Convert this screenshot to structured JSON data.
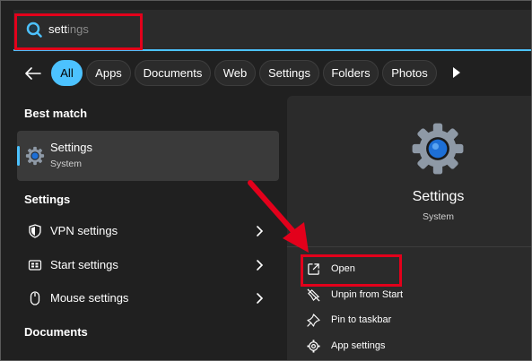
{
  "search": {
    "typed": "sett",
    "suggestion": "ings"
  },
  "filters": [
    "All",
    "Apps",
    "Documents",
    "Web",
    "Settings",
    "Folders",
    "Photos"
  ],
  "best_match": {
    "heading": "Best match",
    "title": "Settings",
    "subtitle": "System"
  },
  "settings_section": {
    "heading": "Settings",
    "items": [
      {
        "label": "VPN settings",
        "icon": "shield-icon"
      },
      {
        "label": "Start settings",
        "icon": "start-icon"
      },
      {
        "label": "Mouse settings",
        "icon": "mouse-icon"
      }
    ]
  },
  "documents_section": {
    "heading": "Documents"
  },
  "detail": {
    "title": "Settings",
    "subtitle": "System",
    "actions": [
      {
        "label": "Open",
        "icon": "open-external-icon"
      },
      {
        "label": "Unpin from Start",
        "icon": "unpin-icon"
      },
      {
        "label": "Pin to taskbar",
        "icon": "pin-icon"
      },
      {
        "label": "App settings",
        "icon": "gear-icon"
      }
    ]
  },
  "colors": {
    "accent": "#4cc2ff",
    "annotation": "#e3001b",
    "background": "#202020",
    "panel": "#2b2b2b"
  }
}
